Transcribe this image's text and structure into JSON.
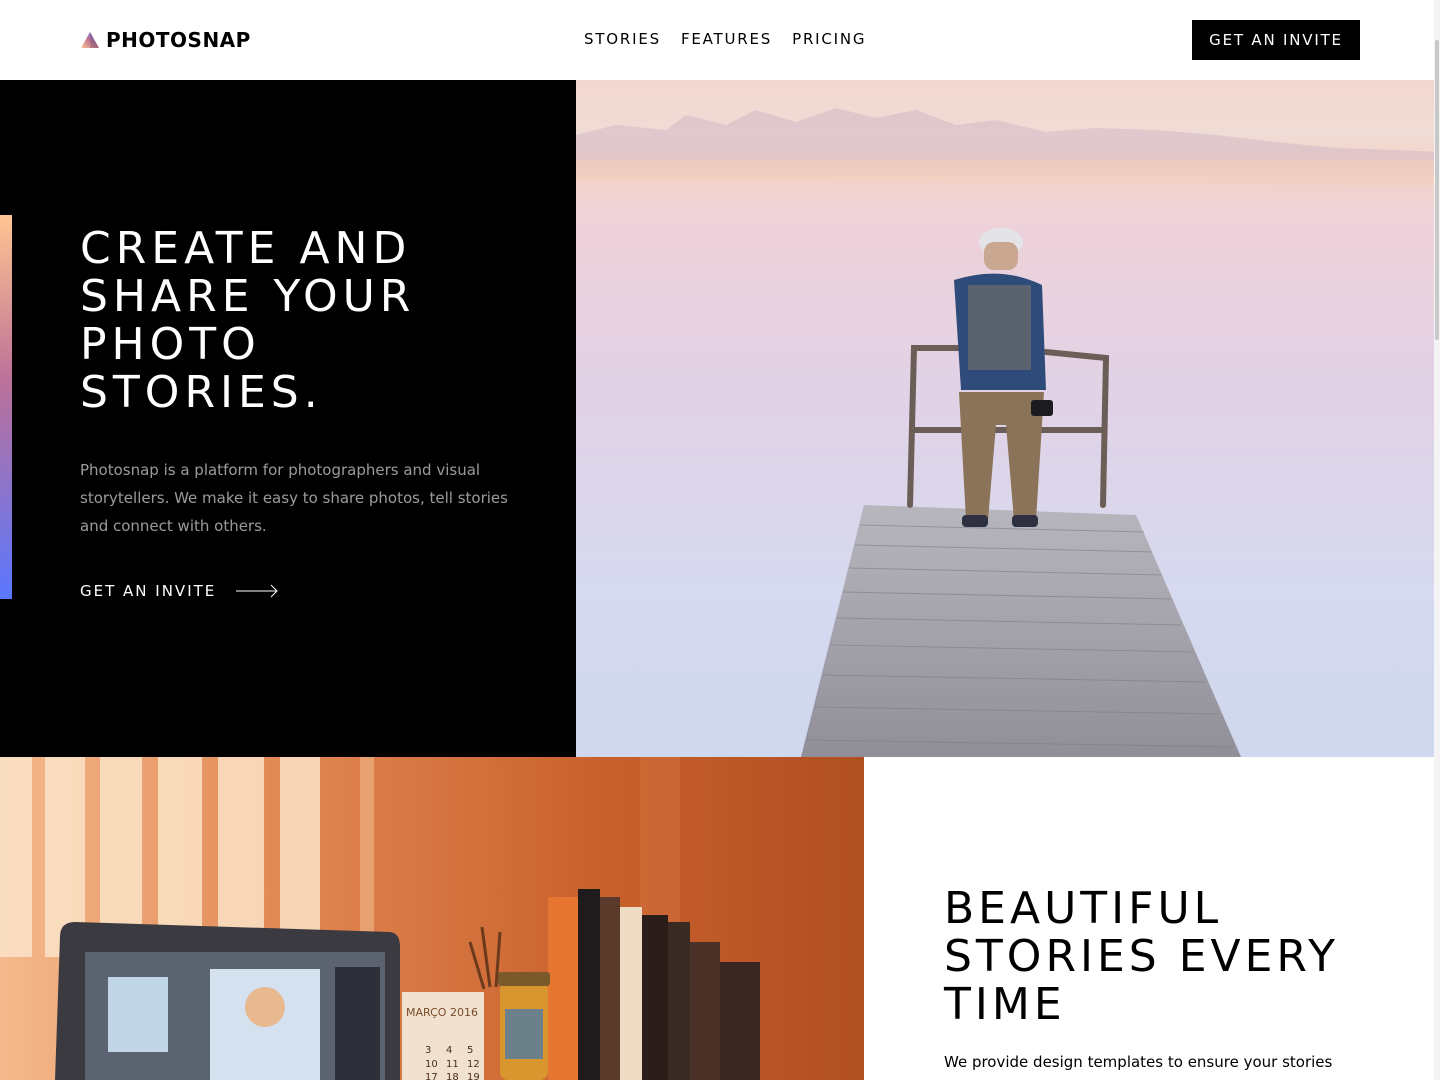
{
  "header": {
    "brand": "PHOTOSNAP",
    "nav": [
      "STORIES",
      "FEATURES",
      "PRICING"
    ],
    "cta": "GET AN INVITE"
  },
  "hero": {
    "title": "CREATE AND SHARE YOUR PHOTO STORIES.",
    "description": "Photosnap is a platform for photographers and visual storytellers. We make it easy to share photos, tell stories and connect with others.",
    "link": "GET AN INVITE",
    "accent_colors": [
      "#FFC593",
      "#BC7198",
      "#5A77FF"
    ]
  },
  "section2": {
    "title": "BEAUTIFUL STORIES EVERY TIME",
    "description": "We provide design templates to ensure your stories",
    "calendar_text": "MARÇO 2016",
    "calendar_days": [
      "3",
      "4",
      "5",
      "10",
      "11",
      "12",
      "17",
      "18",
      "19"
    ]
  }
}
